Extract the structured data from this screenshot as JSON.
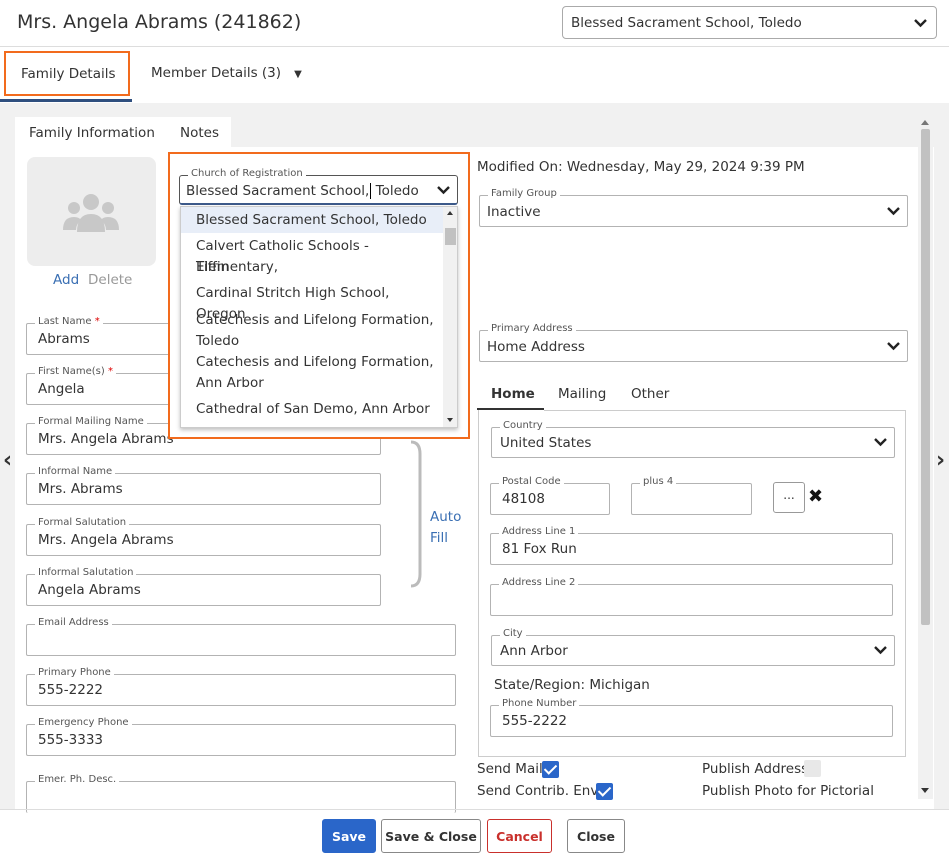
{
  "header": {
    "title": "Mrs. Angela Abrams (241862)",
    "school_select": "Blessed Sacrament School, Toledo"
  },
  "top_tabs": {
    "family_details": "Family Details",
    "member_details": "Member Details (3)",
    "caret": "▼"
  },
  "sub_tabs": {
    "family_info": "Family Information",
    "notes": "Notes"
  },
  "photo": {
    "add": "Add",
    "delete": "Delete"
  },
  "church": {
    "label": "Church of Registration",
    "value_before": "Blessed Sacrament School,",
    "value_after": " Toledo",
    "options": [
      "Blessed Sacrament School, Toledo",
      "Calvert Catholic Schools - Elementary,",
      "Tiffin",
      "Cardinal Stritch High School, Oregon",
      "Catechesis and Lifelong Formation,",
      "Toledo",
      "Catechesis and Lifelong Formation,",
      "Ann Arbor",
      "Cathedral of San Demo, Ann Arbor"
    ]
  },
  "left_fields": {
    "last_name": {
      "label": "Last Name",
      "req": "*",
      "value": "Abrams"
    },
    "first_name": {
      "label": "First Name(s)",
      "req": "*",
      "value": "Angela"
    },
    "formal_mailing": {
      "label": "Formal Mailing Name",
      "value": "Mrs. Angela Abrams"
    },
    "informal_name": {
      "label": "Informal Name",
      "value": "Mrs. Abrams"
    },
    "formal_salutation": {
      "label": "Formal Salutation",
      "value": "Mrs. Angela Abrams"
    },
    "informal_salutation": {
      "label": "Informal Salutation",
      "value": "Angela Abrams"
    },
    "email": {
      "label": "Email Address",
      "value": ""
    },
    "primary_phone": {
      "label": "Primary Phone",
      "value": "555-2222"
    },
    "emergency_phone": {
      "label": "Emergency Phone",
      "value": "555-3333"
    },
    "emer_desc": {
      "label": "Emer. Ph. Desc.",
      "value": ""
    }
  },
  "auto_fill": {
    "line1": "Auto",
    "line2": "Fill"
  },
  "right": {
    "modified": "Modified On: Wednesday, May 29, 2024 9:39 PM",
    "family_group": {
      "label": "Family Group",
      "value": "Inactive"
    },
    "primary_address": {
      "label": "Primary Address",
      "value": "Home Address"
    },
    "addr_tabs": {
      "home": "Home",
      "mailing": "Mailing",
      "other": "Other"
    },
    "country": {
      "label": "Country",
      "value": "United States"
    },
    "postal": {
      "label": "Postal Code",
      "value": "48108"
    },
    "plus4": {
      "label": "plus 4",
      "value": ""
    },
    "lookup": "...",
    "clear": "✖",
    "addr1": {
      "label": "Address Line 1",
      "value": "81 Fox Run"
    },
    "addr2": {
      "label": "Address Line 2",
      "value": ""
    },
    "city": {
      "label": "City",
      "value": "Ann Arbor"
    },
    "state": "State/Region: Michigan",
    "phone": {
      "label": "Phone Number",
      "value": "555-2222"
    },
    "send_mail": "Send Mail",
    "send_contrib": "Send Contrib. Env.",
    "publish_address": "Publish Address",
    "publish_photo": "Publish Photo for Pictorial"
  },
  "footer": {
    "save": "Save",
    "save_close": "Save & Close",
    "cancel": "Cancel",
    "close": "Close"
  },
  "nav": {
    "prev": "‹",
    "next": "›"
  },
  "colors": {
    "highlight": "#f26b1d",
    "primary": "#2a66c9",
    "cancel": "#c9302c"
  }
}
